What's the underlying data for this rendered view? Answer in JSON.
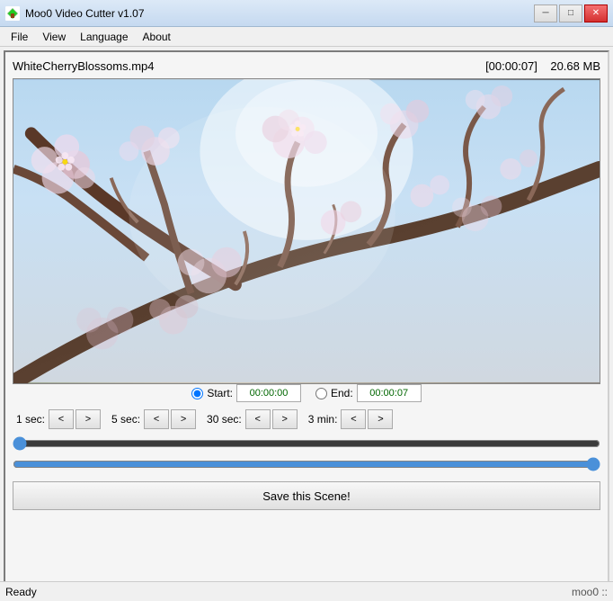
{
  "titleBar": {
    "title": "Moo0 Video Cutter v1.07",
    "minimize": "─",
    "restore": "□",
    "close": "✕"
  },
  "menuBar": {
    "items": [
      "File",
      "View",
      "Language",
      "About"
    ]
  },
  "fileInfo": {
    "fileName": "WhiteCherryBlossoms.mp4",
    "timestamp": "[00:00:07]",
    "fileSize": "20.68 MB"
  },
  "controls": {
    "startLabel": "Start:",
    "startValue": "00:00:00",
    "endLabel": "End:",
    "endValue": "00:00:07"
  },
  "stepControls": [
    {
      "label": "1 sec:",
      "back": "<",
      "forward": ">"
    },
    {
      "label": "5 sec:",
      "back": "<",
      "forward": ">"
    },
    {
      "label": "30 sec:",
      "back": "<",
      "forward": ">"
    },
    {
      "label": "3 min:",
      "back": "<",
      "forward": ">"
    }
  ],
  "sliders": {
    "startValue": 0,
    "endValue": 100
  },
  "saveButton": {
    "label": "Save this Scene!"
  },
  "statusBar": {
    "status": "Ready",
    "link": "moo0 ::"
  }
}
